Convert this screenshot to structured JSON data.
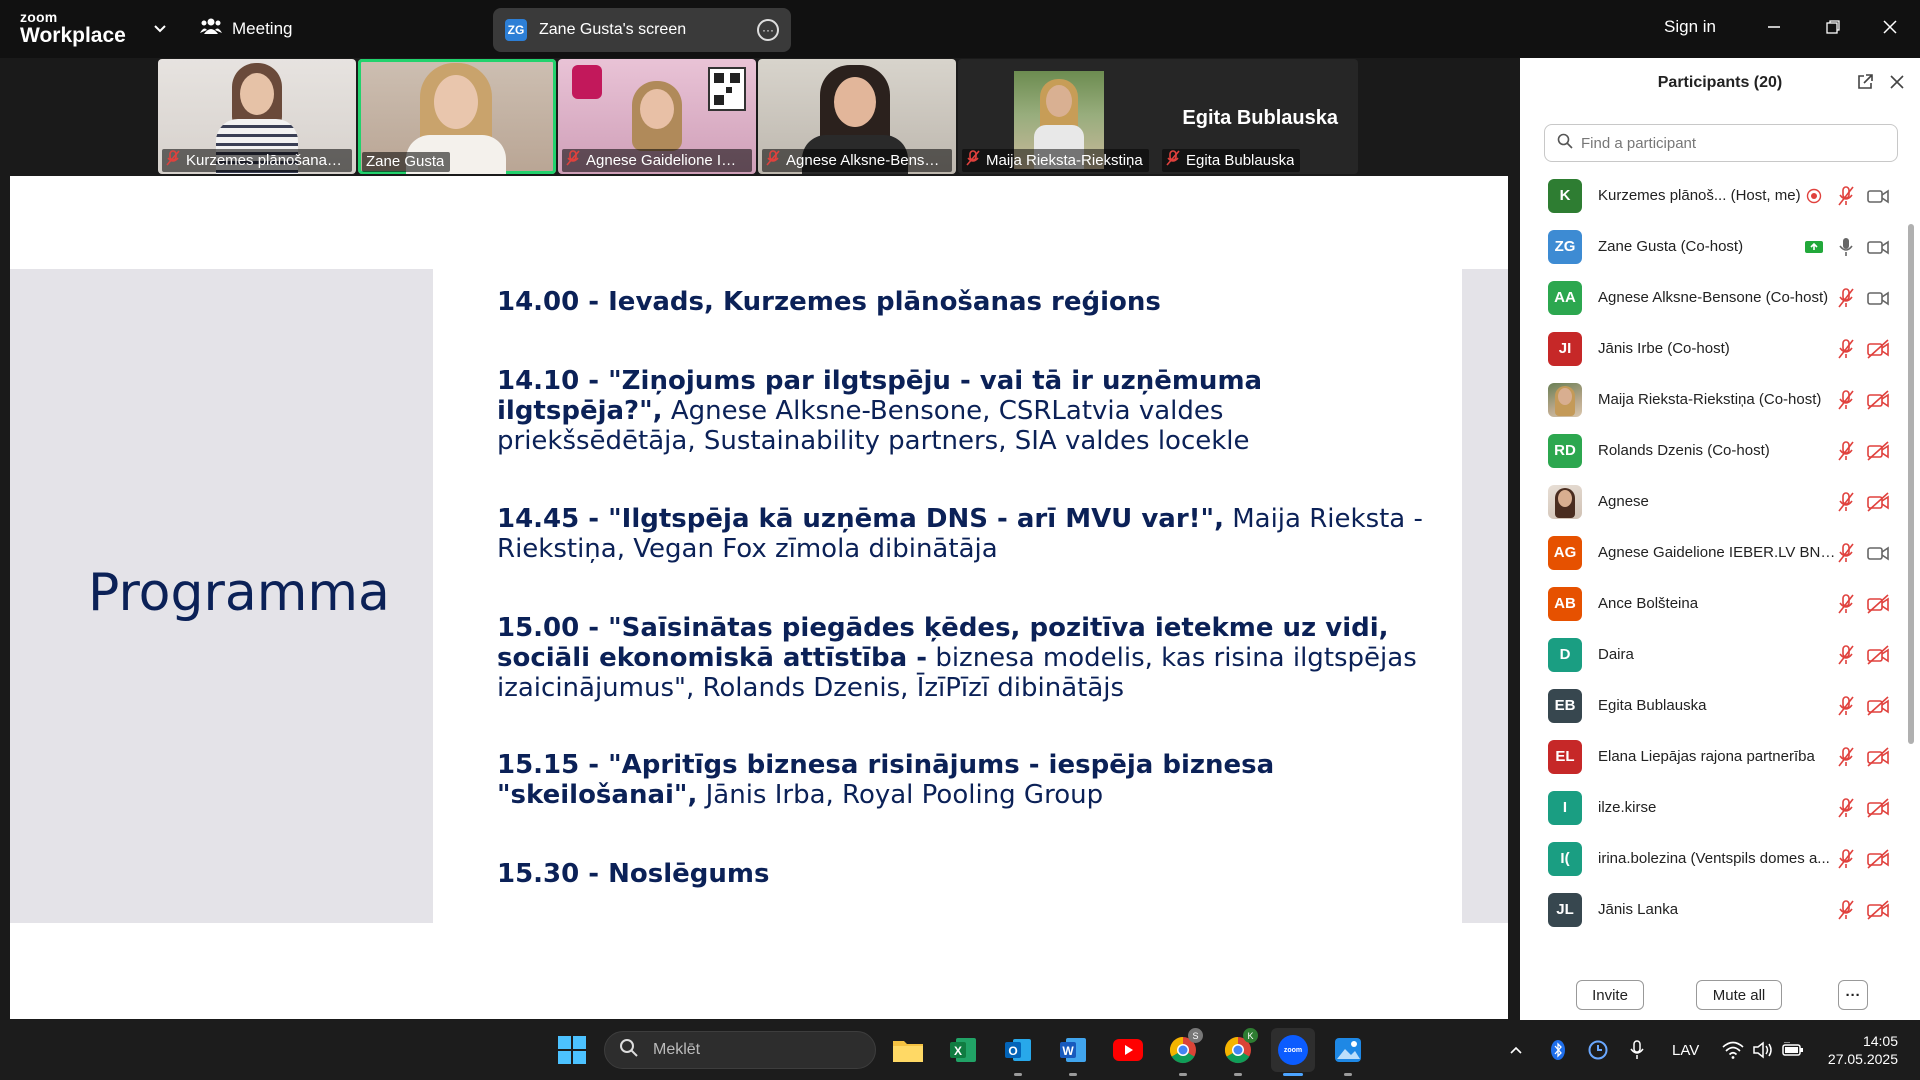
{
  "titlebar": {
    "logo_top": "zoom",
    "logo_bottom": "Workplace",
    "meeting_label": "Meeting",
    "share_badge": "ZG",
    "share_title": "Zane Gusta's screen",
    "signin": "Sign in"
  },
  "video_tiles": [
    {
      "name": "Kurzemes plānošanas ..."
    },
    {
      "name": "Zane Gusta"
    },
    {
      "name": "Agnese Gaidelione IEB..."
    },
    {
      "name": "Agnese Alksne-Bensone"
    },
    {
      "name": "Maija Rieksta-Riekstiņa"
    },
    {
      "name": "Egita Bublauska",
      "display_name": "Egita Bublauska"
    }
  ],
  "slide": {
    "title": "Programma",
    "items": [
      {
        "bold": "14.00 - Ievads, Kurzemes plānošanas reģions",
        "normal": ""
      },
      {
        "bold": "14.10 - \"Ziņojums par ilgtspēju - vai tā ir uzņēmuma ilgtspēja?\",",
        "normal": "Agnese Alksne-Bensone, CSRLatvia valdes priekšsēdētāja, Sustainability partners, SIA valdes locekle"
      },
      {
        "bold": "14.45 - \"Ilgtspēja kā uzņēma DNS - arī MVU var!\",",
        "normal": "Maija Rieksta - Riekstiņa, Vegan Fox zīmola dibinātāja"
      },
      {
        "bold": "15.00 - \"Saīsinātas piegādes ķēdes, pozitīva ietekme uz vidi, sociāli ekonomiskā attīstība -",
        "normal": "biznesa modelis, kas risina ilgtspējas izaicinājumus\", Rolands Dzenis, ĪzīPīzī dibinātājs"
      },
      {
        "bold": "15.15 - \"Apritīgs biznesa risinājums - iespēja biznesa \"skeilošanai\",",
        "normal": "Jānis Irba, Royal Pooling Group"
      },
      {
        "bold": "15.30 - Noslēgums",
        "normal": ""
      }
    ]
  },
  "participants": {
    "title": "Participants (20)",
    "search_placeholder": "Find a participant",
    "list": [
      {
        "initials": "K",
        "name": "Kurzemes plānoš...",
        "role": "(Host, me)",
        "color": "#2e7d32"
      },
      {
        "initials": "ZG",
        "name": "Zane Gusta",
        "role": "(Co-host)",
        "color": "#3d8bd3"
      },
      {
        "initials": "AA",
        "name": "Agnese Alksne-Bensone",
        "role": "(Co-host)",
        "color": "#2ca74f"
      },
      {
        "initials": "JI",
        "name": "Jānis Irbe",
        "role": "(Co-host)",
        "color": "#c62828"
      },
      {
        "initials": "",
        "name": "Maija Rieksta-Riekstiņa",
        "role": "(Co-host)",
        "color": "#8aa06e"
      },
      {
        "initials": "RD",
        "name": "Rolands Dzenis",
        "role": "(Co-host)",
        "color": "#2ca74f"
      },
      {
        "initials": "",
        "name": "Agnese",
        "role": "",
        "color": "#d8c8b8"
      },
      {
        "initials": "AG",
        "name": "Agnese Gaidelione IEBER.LV BNI ...",
        "role": "",
        "color": "#e65100"
      },
      {
        "initials": "AB",
        "name": "Ance Bolšteina",
        "role": "",
        "color": "#e65100"
      },
      {
        "initials": "D",
        "name": "Daira",
        "role": "",
        "color": "#1a9e82"
      },
      {
        "initials": "EB",
        "name": "Egita Bublauska",
        "role": "",
        "color": "#37474f"
      },
      {
        "initials": "EL",
        "name": "Elana Liepājas rajona partnerība",
        "role": "",
        "color": "#c62828"
      },
      {
        "initials": "I",
        "name": "ilze.kirse",
        "role": "",
        "color": "#1a9e82"
      },
      {
        "initials": "I(",
        "name": "irina.bolezina (Ventspils domes a...",
        "role": "",
        "color": "#1a9e82"
      },
      {
        "initials": "JL",
        "name": "Jānis Lanka",
        "role": "",
        "color": "#37474f"
      },
      {
        "initials": "",
        "name": "",
        "role": "",
        "color": "#1a9e82"
      }
    ],
    "invite": "Invite",
    "mute_all": "Mute all",
    "more": "···"
  },
  "taskbar": {
    "search_placeholder": "Meklēt",
    "lang": "LAV",
    "time": "14:05",
    "date": "27.05.2025",
    "chrome_badge_1": "S",
    "chrome_badge_2": "K",
    "zoom_label": "zoom"
  },
  "colors": {
    "slide_text": "#0b2157",
    "slide_band": "#e4e3e8",
    "active_speaker": "#22d26d",
    "muted_icon": "#e0413d"
  }
}
